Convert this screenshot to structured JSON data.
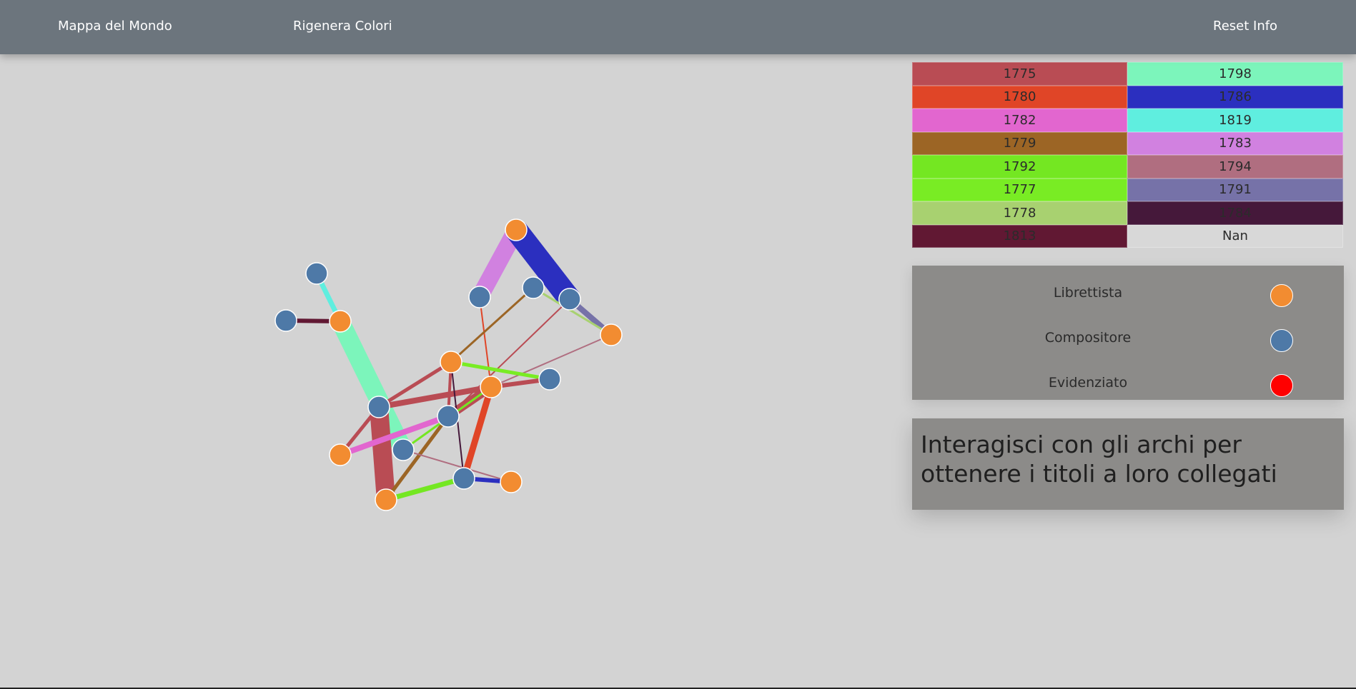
{
  "navbar": {
    "items": [
      "Mappa del Mondo",
      "Rigenera Colori",
      "Reset Info"
    ]
  },
  "year_colors": [
    {
      "year": "1775",
      "color": "#b94c54"
    },
    {
      "year": "1798",
      "color": "#7cf5bb"
    },
    {
      "year": "1780",
      "color": "#e04527"
    },
    {
      "year": "1786",
      "color": "#2b2fbf"
    },
    {
      "year": "1782",
      "color": "#e266cf"
    },
    {
      "year": "1819",
      "color": "#5feedf"
    },
    {
      "year": "1779",
      "color": "#9c6525"
    },
    {
      "year": "1783",
      "color": "#d181e0"
    },
    {
      "year": "1792",
      "color": "#74e722"
    },
    {
      "year": "1794",
      "color": "#b06e80"
    },
    {
      "year": "1777",
      "color": "#79ec24"
    },
    {
      "year": "1791",
      "color": "#7672a8"
    },
    {
      "year": "1778",
      "color": "#a8d170"
    },
    {
      "year": "1784",
      "color": "#45183a"
    },
    {
      "year": "1813",
      "color": "#611833"
    },
    {
      "year": "Nan",
      "color": "#d8d8d8"
    }
  ],
  "legend": [
    {
      "label": "Librettista",
      "color": "#f28c31"
    },
    {
      "label": "Compositore",
      "color": "#4e79a7"
    },
    {
      "label": "Evidenziato",
      "color": "#ff0000"
    }
  ],
  "info": {
    "text": "Interagisci con gli archi per ottenere i titoli a loro collegati"
  },
  "node_colors": {
    "librettista": "#f28c31",
    "compositore": "#4e79a7"
  },
  "graph": {
    "nodes": [
      {
        "id": "c1",
        "type": "compositore"
      },
      {
        "id": "c2",
        "type": "compositore"
      },
      {
        "id": "l1",
        "type": "librettista"
      },
      {
        "id": "l2",
        "type": "librettista"
      },
      {
        "id": "c3",
        "type": "compositore"
      },
      {
        "id": "c4",
        "type": "compositore"
      },
      {
        "id": "c5",
        "type": "compositore"
      },
      {
        "id": "l3",
        "type": "librettista"
      },
      {
        "id": "l4",
        "type": "librettista"
      },
      {
        "id": "l5",
        "type": "librettista"
      },
      {
        "id": "c6",
        "type": "compositore"
      },
      {
        "id": "c7",
        "type": "compositore"
      },
      {
        "id": "c8",
        "type": "compositore"
      },
      {
        "id": "l6",
        "type": "librettista"
      },
      {
        "id": "c9",
        "type": "compositore"
      },
      {
        "id": "l7",
        "type": "librettista"
      },
      {
        "id": "c10",
        "type": "compositore"
      },
      {
        "id": "l8",
        "type": "librettista"
      }
    ],
    "links": [
      {
        "s": "c1",
        "t": "l1",
        "year": "1819",
        "w": 7
      },
      {
        "s": "c2",
        "t": "l1",
        "year": "1813",
        "w": 6
      },
      {
        "s": "l1",
        "t": "c9",
        "year": "1798",
        "w": 26
      },
      {
        "s": "l2",
        "t": "c3",
        "year": "1783",
        "w": 24
      },
      {
        "s": "l2",
        "t": "c5",
        "year": "1786",
        "w": 32
      },
      {
        "s": "c5",
        "t": "l3",
        "year": "1791",
        "w": 8
      },
      {
        "s": "c4",
        "t": "l3",
        "year": "1778",
        "w": 3
      },
      {
        "s": "c3",
        "t": "l5",
        "year": "1780",
        "w": 2
      },
      {
        "s": "c4",
        "t": "l4",
        "year": "1779",
        "w": 3
      },
      {
        "s": "c5",
        "t": "c8",
        "year": "1775",
        "w": 2
      },
      {
        "s": "l3",
        "t": "l5",
        "year": "1794",
        "w": 2
      },
      {
        "s": "l4",
        "t": "c6",
        "year": "1777",
        "w": 5
      },
      {
        "s": "l5",
        "t": "c6",
        "year": "1775",
        "w": 6
      },
      {
        "s": "c7",
        "t": "l5",
        "year": "1775",
        "w": 8
      },
      {
        "s": "c7",
        "t": "l4",
        "year": "1775",
        "w": 5
      },
      {
        "s": "c7",
        "t": "l7",
        "year": "1775",
        "w": 26
      },
      {
        "s": "c7",
        "t": "l6",
        "year": "1775",
        "w": 5
      },
      {
        "s": "l6",
        "t": "c8",
        "year": "1782",
        "w": 8
      },
      {
        "s": "c8",
        "t": "l4",
        "year": "1775",
        "w": 4
      },
      {
        "s": "c8",
        "t": "l5",
        "year": "1775",
        "w": 12
      },
      {
        "s": "c8",
        "t": "l7",
        "year": "1779",
        "w": 5
      },
      {
        "s": "l5",
        "t": "c10",
        "year": "1780",
        "w": 9
      },
      {
        "s": "l4",
        "t": "c10",
        "year": "1784",
        "w": 2
      },
      {
        "s": "c9",
        "t": "l8",
        "year": "1794",
        "w": 2
      },
      {
        "s": "c9",
        "t": "l5",
        "year": "1792",
        "w": 3
      },
      {
        "s": "l7",
        "t": "c10",
        "year": "1792",
        "w": 7
      },
      {
        "s": "c10",
        "t": "l8",
        "year": "1786",
        "w": 6
      }
    ]
  }
}
